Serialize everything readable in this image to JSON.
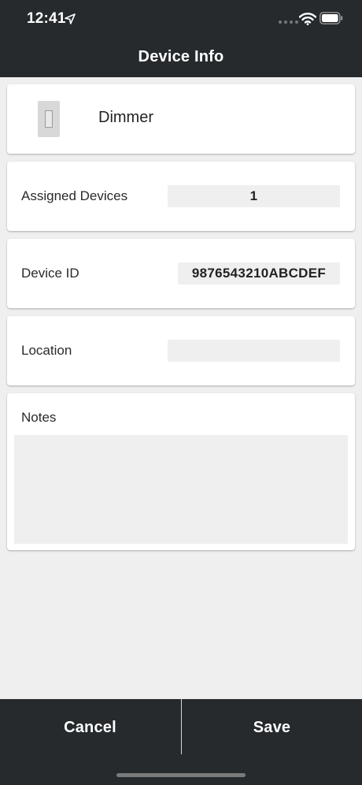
{
  "status_bar": {
    "time": "12:41"
  },
  "nav": {
    "title": "Device Info"
  },
  "device": {
    "name": "Dimmer"
  },
  "assigned_devices": {
    "label": "Assigned Devices",
    "value": "1"
  },
  "device_id": {
    "label": "Device ID",
    "value": "9876543210ABCDEF"
  },
  "location": {
    "label": "Location",
    "value": ""
  },
  "notes": {
    "label": "Notes",
    "value": ""
  },
  "actions": {
    "cancel_label": "Cancel",
    "save_label": "Save"
  },
  "colors": {
    "bar_background": "#262a2d",
    "page_background": "#efefef",
    "card_background": "#ffffff",
    "field_background": "#efefef"
  },
  "icons": {
    "location_arrow": "location-arrow-icon",
    "wifi": "wifi-icon",
    "battery": "battery-icon",
    "device": "dimmer-switch-icon"
  }
}
